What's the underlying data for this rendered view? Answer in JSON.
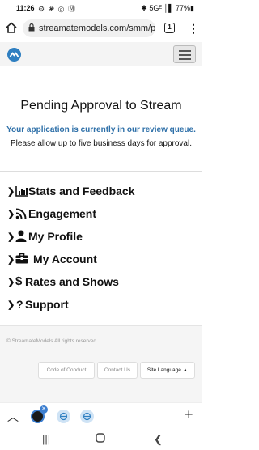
{
  "status_bar": {
    "time": "11:26",
    "left_icons": "⚙ ❀ ◎ Ⓜ",
    "right_text": "✱ 5Gᴱ │▌ 77%▮"
  },
  "browser": {
    "url": "streamatemodels.com/smm/pe",
    "tab_count": "1"
  },
  "page": {
    "heading": "Pending Approval to Stream",
    "review_text": "Your application is currently in our review queue.",
    "allow_text": "Please allow up to five business days for approval."
  },
  "menu": {
    "items": [
      {
        "label": "Stats and Feedback",
        "icon": "bar-chart-icon"
      },
      {
        "label": "Engagement",
        "icon": "rss-icon"
      },
      {
        "label": "My Profile",
        "icon": "user-icon"
      },
      {
        "label": "My Account",
        "icon": "briefcase-icon"
      },
      {
        "label": "Rates and Shows",
        "icon": "dollar-icon"
      },
      {
        "label": "Support",
        "icon": "question-icon"
      }
    ]
  },
  "footer": {
    "copyright": "© StreamateModels All rights reserved.",
    "code_of_conduct": "Code of Conduct",
    "contact_us": "Contact Us",
    "site_language": "Site Language ▲"
  },
  "colors": {
    "accent_blue": "#2d6fa8",
    "logo_blue": "#2f7fc1"
  }
}
